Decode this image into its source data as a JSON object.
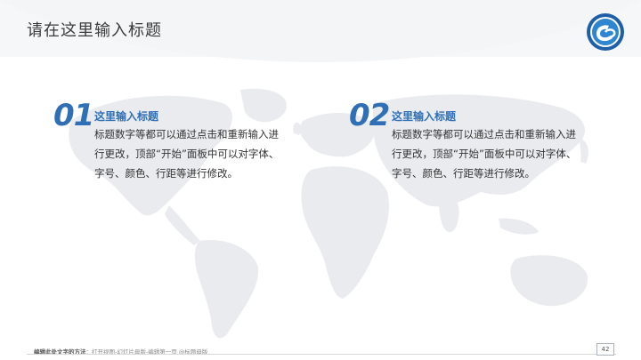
{
  "slide": {
    "title": "请在这里输入标题",
    "page_number": "42",
    "footer_label": "编辑此处文字的方法",
    "footer_text": "：打开视图-幻灯片母版-编辑第一页 @标题母版",
    "colors": {
      "accent": "#2f6fb6",
      "text": "#333333",
      "map": "#e9ebee"
    }
  },
  "blocks": [
    {
      "number": "01",
      "heading": "这里输入标题",
      "lines": [
        "标题数字等都可以通过点击和重新输入进",
        "行更改，顶部“开始”面板中可以对字体、",
        "字号、颜色、行距等进行修改。"
      ]
    },
    {
      "number": "02",
      "heading": "这里输入标题",
      "lines": [
        "标题数字等都可以通过点击和重新输入进",
        "行更改，顶部“开始”面板中可以对字体、",
        "字号、颜色、行距等进行修改。"
      ]
    }
  ],
  "icons": {
    "logo": "university-emblem-icon",
    "map": "world-map-icon"
  }
}
